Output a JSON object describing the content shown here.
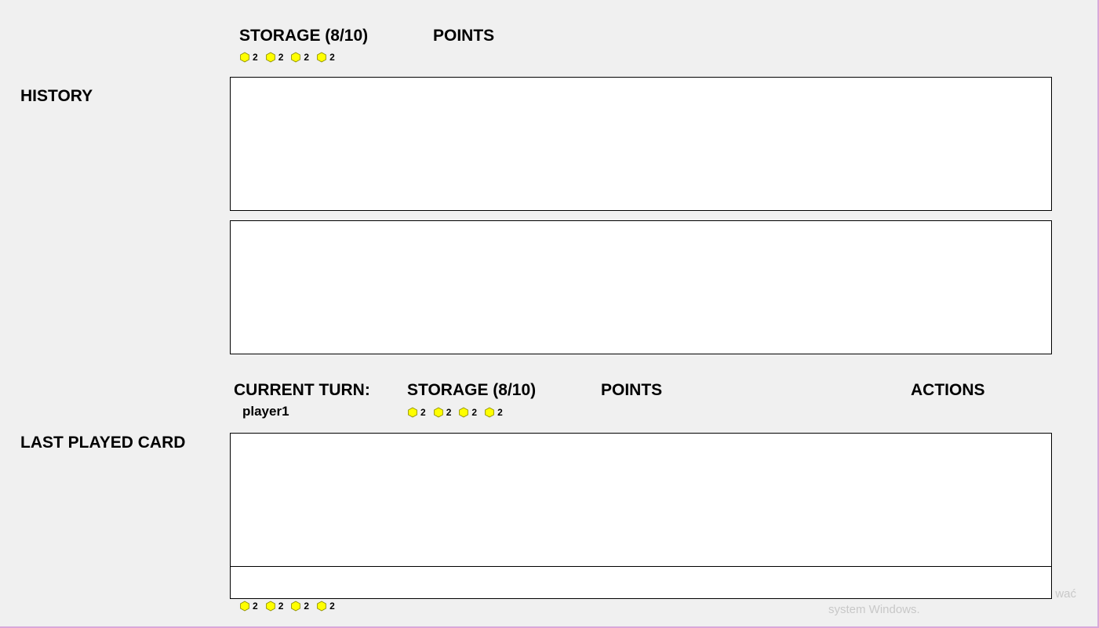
{
  "opponent": {
    "storage_label": "STORAGE (8/10)",
    "points_label": "POINTS",
    "resources": [
      {
        "icon": "yellow-hexagon-icon",
        "count": "2"
      },
      {
        "icon": "yellow-hexagon-icon",
        "count": "2"
      },
      {
        "icon": "yellow-hexagon-icon",
        "count": "2"
      },
      {
        "icon": "yellow-hexagon-icon",
        "count": "2"
      }
    ]
  },
  "history": {
    "label": "HISTORY"
  },
  "player": {
    "current_turn_label": "CURRENT TURN:",
    "current_turn_value": "player1",
    "storage_label": "STORAGE (8/10)",
    "points_label": "POINTS",
    "actions_label": "ACTIONS",
    "resources": [
      {
        "icon": "yellow-hexagon-icon",
        "count": "2"
      },
      {
        "icon": "yellow-hexagon-icon",
        "count": "2"
      },
      {
        "icon": "yellow-hexagon-icon",
        "count": "2"
      },
      {
        "icon": "yellow-hexagon-icon",
        "count": "2"
      }
    ]
  },
  "last_played": {
    "label": "LAST PLAYED CARD"
  },
  "hand": {
    "resources": [
      {
        "icon": "yellow-hexagon-icon",
        "count": "2"
      },
      {
        "icon": "yellow-hexagon-icon",
        "count": "2"
      },
      {
        "icon": "yellow-hexagon-icon",
        "count": "2"
      },
      {
        "icon": "yellow-hexagon-icon",
        "count": "2"
      }
    ]
  },
  "watermark": {
    "line1": "wać",
    "line2": "system Windows."
  },
  "colors": {
    "resource": "#ffff00",
    "resource_stroke": "#8a8a00",
    "frame_border": "#d9a7d9",
    "background": "#f0f0f0"
  }
}
